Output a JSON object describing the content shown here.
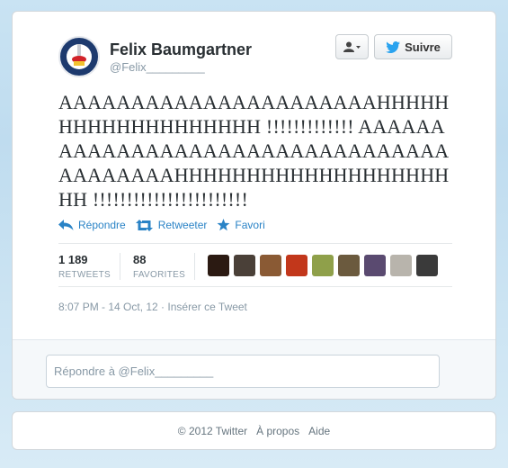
{
  "author": {
    "name": "Felix Baumgartner",
    "handle": "@Felix_________"
  },
  "buttons": {
    "follow_label": "Suivre"
  },
  "tweet": {
    "text": "AAAAAAAAAAAAAAAAAAAAAAHHHHHHHHHHHHHHHHHHH !!!!!!!!!!!!! AAAAAAAAAAAAAAAAAAAAAAAAAAAAAAAAAAAAAAAAAHHHHHHHHHHHHHHHHHHHHH !!!!!!!!!!!!!!!!!!!!!!!",
    "timestamp": "8:07 PM - 14 Oct, 12 · Insérer ce Tweet"
  },
  "actions": {
    "reply": "Répondre",
    "retweet": "Retweeter",
    "favorite": "Favori"
  },
  "stats": {
    "retweets_count": "1 189",
    "retweets_label": "RETWEETS",
    "favorites_count": "88",
    "favorites_label": "FAVORITES"
  },
  "favoriters": {
    "avatar_colors": [
      "#2b1a12",
      "#4a4038",
      "#8a5a34",
      "#c2371b",
      "#8fa04a",
      "#6b5a3e",
      "#5a4a70",
      "#b8b4ac",
      "#3a3a3a"
    ]
  },
  "reply": {
    "placeholder": "Répondre à @Felix_________"
  },
  "footer": {
    "copyright": "© 2012 Twitter",
    "about": "À propos",
    "help": "Aide"
  },
  "colors": {
    "link": "#2a83c6",
    "text": "#292f33",
    "muted": "#8899a6"
  }
}
